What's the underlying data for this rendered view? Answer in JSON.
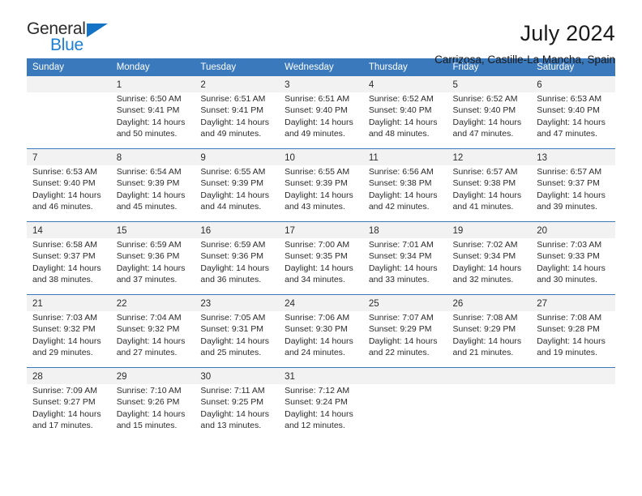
{
  "brand": {
    "name_part1": "General",
    "name_part2": "Blue",
    "triangle_icon": "triangle-icon",
    "accent_color": "#1b7fd4"
  },
  "header": {
    "title": "July 2024",
    "subtitle": "Carrizosa, Castille-La Mancha, Spain"
  },
  "calendar": {
    "header_color": "#3b79bd",
    "daynum_bg": "#f2f2f2",
    "weekday_headers": [
      "Sunday",
      "Monday",
      "Tuesday",
      "Wednesday",
      "Thursday",
      "Friday",
      "Saturday"
    ],
    "weeks": [
      {
        "days": [
          {
            "number": "",
            "sunrise": "",
            "sunset": "",
            "daylight_line1": "",
            "daylight_line2": ""
          },
          {
            "number": "1",
            "sunrise": "Sunrise: 6:50 AM",
            "sunset": "Sunset: 9:41 PM",
            "daylight_line1": "Daylight: 14 hours",
            "daylight_line2": "and 50 minutes."
          },
          {
            "number": "2",
            "sunrise": "Sunrise: 6:51 AM",
            "sunset": "Sunset: 9:41 PM",
            "daylight_line1": "Daylight: 14 hours",
            "daylight_line2": "and 49 minutes."
          },
          {
            "number": "3",
            "sunrise": "Sunrise: 6:51 AM",
            "sunset": "Sunset: 9:40 PM",
            "daylight_line1": "Daylight: 14 hours",
            "daylight_line2": "and 49 minutes."
          },
          {
            "number": "4",
            "sunrise": "Sunrise: 6:52 AM",
            "sunset": "Sunset: 9:40 PM",
            "daylight_line1": "Daylight: 14 hours",
            "daylight_line2": "and 48 minutes."
          },
          {
            "number": "5",
            "sunrise": "Sunrise: 6:52 AM",
            "sunset": "Sunset: 9:40 PM",
            "daylight_line1": "Daylight: 14 hours",
            "daylight_line2": "and 47 minutes."
          },
          {
            "number": "6",
            "sunrise": "Sunrise: 6:53 AM",
            "sunset": "Sunset: 9:40 PM",
            "daylight_line1": "Daylight: 14 hours",
            "daylight_line2": "and 47 minutes."
          }
        ]
      },
      {
        "days": [
          {
            "number": "7",
            "sunrise": "Sunrise: 6:53 AM",
            "sunset": "Sunset: 9:40 PM",
            "daylight_line1": "Daylight: 14 hours",
            "daylight_line2": "and 46 minutes."
          },
          {
            "number": "8",
            "sunrise": "Sunrise: 6:54 AM",
            "sunset": "Sunset: 9:39 PM",
            "daylight_line1": "Daylight: 14 hours",
            "daylight_line2": "and 45 minutes."
          },
          {
            "number": "9",
            "sunrise": "Sunrise: 6:55 AM",
            "sunset": "Sunset: 9:39 PM",
            "daylight_line1": "Daylight: 14 hours",
            "daylight_line2": "and 44 minutes."
          },
          {
            "number": "10",
            "sunrise": "Sunrise: 6:55 AM",
            "sunset": "Sunset: 9:39 PM",
            "daylight_line1": "Daylight: 14 hours",
            "daylight_line2": "and 43 minutes."
          },
          {
            "number": "11",
            "sunrise": "Sunrise: 6:56 AM",
            "sunset": "Sunset: 9:38 PM",
            "daylight_line1": "Daylight: 14 hours",
            "daylight_line2": "and 42 minutes."
          },
          {
            "number": "12",
            "sunrise": "Sunrise: 6:57 AM",
            "sunset": "Sunset: 9:38 PM",
            "daylight_line1": "Daylight: 14 hours",
            "daylight_line2": "and 41 minutes."
          },
          {
            "number": "13",
            "sunrise": "Sunrise: 6:57 AM",
            "sunset": "Sunset: 9:37 PM",
            "daylight_line1": "Daylight: 14 hours",
            "daylight_line2": "and 39 minutes."
          }
        ]
      },
      {
        "days": [
          {
            "number": "14",
            "sunrise": "Sunrise: 6:58 AM",
            "sunset": "Sunset: 9:37 PM",
            "daylight_line1": "Daylight: 14 hours",
            "daylight_line2": "and 38 minutes."
          },
          {
            "number": "15",
            "sunrise": "Sunrise: 6:59 AM",
            "sunset": "Sunset: 9:36 PM",
            "daylight_line1": "Daylight: 14 hours",
            "daylight_line2": "and 37 minutes."
          },
          {
            "number": "16",
            "sunrise": "Sunrise: 6:59 AM",
            "sunset": "Sunset: 9:36 PM",
            "daylight_line1": "Daylight: 14 hours",
            "daylight_line2": "and 36 minutes."
          },
          {
            "number": "17",
            "sunrise": "Sunrise: 7:00 AM",
            "sunset": "Sunset: 9:35 PM",
            "daylight_line1": "Daylight: 14 hours",
            "daylight_line2": "and 34 minutes."
          },
          {
            "number": "18",
            "sunrise": "Sunrise: 7:01 AM",
            "sunset": "Sunset: 9:34 PM",
            "daylight_line1": "Daylight: 14 hours",
            "daylight_line2": "and 33 minutes."
          },
          {
            "number": "19",
            "sunrise": "Sunrise: 7:02 AM",
            "sunset": "Sunset: 9:34 PM",
            "daylight_line1": "Daylight: 14 hours",
            "daylight_line2": "and 32 minutes."
          },
          {
            "number": "20",
            "sunrise": "Sunrise: 7:03 AM",
            "sunset": "Sunset: 9:33 PM",
            "daylight_line1": "Daylight: 14 hours",
            "daylight_line2": "and 30 minutes."
          }
        ]
      },
      {
        "days": [
          {
            "number": "21",
            "sunrise": "Sunrise: 7:03 AM",
            "sunset": "Sunset: 9:32 PM",
            "daylight_line1": "Daylight: 14 hours",
            "daylight_line2": "and 29 minutes."
          },
          {
            "number": "22",
            "sunrise": "Sunrise: 7:04 AM",
            "sunset": "Sunset: 9:32 PM",
            "daylight_line1": "Daylight: 14 hours",
            "daylight_line2": "and 27 minutes."
          },
          {
            "number": "23",
            "sunrise": "Sunrise: 7:05 AM",
            "sunset": "Sunset: 9:31 PM",
            "daylight_line1": "Daylight: 14 hours",
            "daylight_line2": "and 25 minutes."
          },
          {
            "number": "24",
            "sunrise": "Sunrise: 7:06 AM",
            "sunset": "Sunset: 9:30 PM",
            "daylight_line1": "Daylight: 14 hours",
            "daylight_line2": "and 24 minutes."
          },
          {
            "number": "25",
            "sunrise": "Sunrise: 7:07 AM",
            "sunset": "Sunset: 9:29 PM",
            "daylight_line1": "Daylight: 14 hours",
            "daylight_line2": "and 22 minutes."
          },
          {
            "number": "26",
            "sunrise": "Sunrise: 7:08 AM",
            "sunset": "Sunset: 9:29 PM",
            "daylight_line1": "Daylight: 14 hours",
            "daylight_line2": "and 21 minutes."
          },
          {
            "number": "27",
            "sunrise": "Sunrise: 7:08 AM",
            "sunset": "Sunset: 9:28 PM",
            "daylight_line1": "Daylight: 14 hours",
            "daylight_line2": "and 19 minutes."
          }
        ]
      },
      {
        "days": [
          {
            "number": "28",
            "sunrise": "Sunrise: 7:09 AM",
            "sunset": "Sunset: 9:27 PM",
            "daylight_line1": "Daylight: 14 hours",
            "daylight_line2": "and 17 minutes."
          },
          {
            "number": "29",
            "sunrise": "Sunrise: 7:10 AM",
            "sunset": "Sunset: 9:26 PM",
            "daylight_line1": "Daylight: 14 hours",
            "daylight_line2": "and 15 minutes."
          },
          {
            "number": "30",
            "sunrise": "Sunrise: 7:11 AM",
            "sunset": "Sunset: 9:25 PM",
            "daylight_line1": "Daylight: 14 hours",
            "daylight_line2": "and 13 minutes."
          },
          {
            "number": "31",
            "sunrise": "Sunrise: 7:12 AM",
            "sunset": "Sunset: 9:24 PM",
            "daylight_line1": "Daylight: 14 hours",
            "daylight_line2": "and 12 minutes."
          },
          {
            "number": "",
            "sunrise": "",
            "sunset": "",
            "daylight_line1": "",
            "daylight_line2": ""
          },
          {
            "number": "",
            "sunrise": "",
            "sunset": "",
            "daylight_line1": "",
            "daylight_line2": ""
          },
          {
            "number": "",
            "sunrise": "",
            "sunset": "",
            "daylight_line1": "",
            "daylight_line2": ""
          }
        ]
      }
    ]
  }
}
